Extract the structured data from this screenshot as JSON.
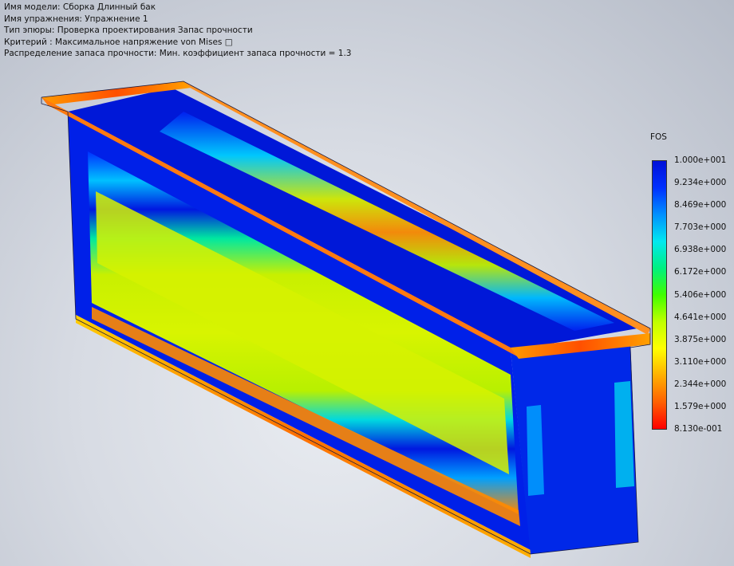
{
  "info": {
    "model_name": "Имя модели: Сборка Длинный бак",
    "study_name": "Имя упражнения: Упражнение 1",
    "plot_type": "Тип эпюры: Проверка проектирования Запас прочности",
    "criterion": "Критерий : Максимальное напряжение von Mises □",
    "distribution": "Распределение запаса прочности: Мин. коэффициент запаса прочности = 1.3"
  },
  "legend": {
    "title": "FOS",
    "ticks": [
      "1.000e+001",
      "9.234e+000",
      "8.469e+000",
      "7.703e+000",
      "6.938e+000",
      "6.172e+000",
      "5.406e+000",
      "4.641e+000",
      "3.875e+000",
      "3.110e+000",
      "2.344e+000",
      "1.579e+000",
      "8.130e-001"
    ],
    "colors": {
      "high": "#0010d8",
      "mid": "#40ff00",
      "low": "#ff0000"
    }
  },
  "model": {
    "description_icon": "fea-tank-model"
  }
}
